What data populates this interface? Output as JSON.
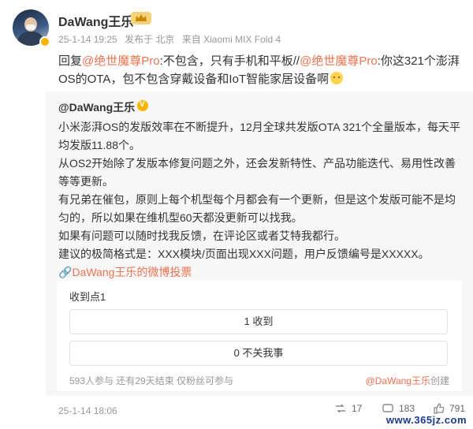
{
  "post": {
    "username": "DaWang王乐",
    "meta": {
      "time": "25-1-14 19:25",
      "location": "发布于 北京",
      "device": "来自 Xiaomi MIX Fold 4"
    },
    "reply": {
      "prefix": "回复",
      "mention1": "@绝世魔尊Pro",
      "text1": ":不包含，只有手机和平板//",
      "mention2": "@绝世魔尊Pro",
      "text2": ":你这321个澎湃OS的OTA，包不包含穿戴设备和IoT智能家居设备啊"
    }
  },
  "quoted": {
    "username": "@DaWang王乐",
    "paragraphs": [
      "小米澎湃OS的发版效率在不断提升，12月全球共发版OTA 321个全量版本，每天平均发版11.88个。",
      "从OS2开始除了发版本修复问题之外，还会发新特性、产品功能迭代、易用性改善等等更新。",
      "有兄弟在催包，原则上每个机型每个月都会有一个更新，但是这个发版可能不是均匀的，所以如果在维机型60天都没更新可以找我。",
      "如果有问题可以随时找我反馈，在评论区或者艾特我都行。"
    ],
    "last_line": "建议的极简格式是：XXX模块/页面出现XXX问题，用户反馈编号是XXXXX。",
    "poll_link": "DaWang王乐的微博投票",
    "poll": {
      "title": "收到点1",
      "options": [
        "1 收到",
        "0 不关我事"
      ],
      "footer": "593人参与  还有29天结束  仅粉丝可参与",
      "creator_mention": "@DaWang王乐",
      "creator_suffix": "创建"
    }
  },
  "footer": {
    "date": "25-1-14 18:06",
    "reposts": "17",
    "comments": "183",
    "likes": "791"
  },
  "watermark": "www.365jz.com",
  "colors": {
    "mention": "#eb7350",
    "muted": "#999999",
    "quote_bg": "#f7f7f7"
  }
}
